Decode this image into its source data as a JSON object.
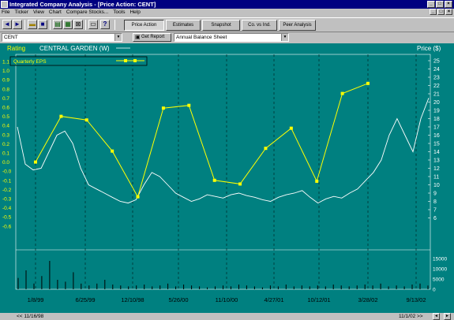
{
  "window": {
    "title": "Integrated Company Analysis - [Price Action:  CENT]"
  },
  "menu": [
    "File",
    "Ticker",
    "View",
    "Chart",
    "Compare Stocks...",
    "Tools",
    "Help"
  ],
  "toolbar": {
    "tabs": [
      {
        "label": "Price Action",
        "active": true
      },
      {
        "label": "Estimates",
        "active": false
      },
      {
        "label": "Snapshot",
        "active": false
      },
      {
        "label": "Co. vs Ind.",
        "active": false
      },
      {
        "label": "Peer Analysis",
        "active": false
      }
    ]
  },
  "ticker_combo": {
    "value": "CENT"
  },
  "get_report_label": "Get Report",
  "report_combo": {
    "value": "Annual Balance Sheet"
  },
  "chart": {
    "rating_label": "Rating",
    "company_name": "CENTRAL GARDEN (W)",
    "price_label": "Price ($)",
    "legend_label": "Quarterly EPS",
    "range_start": "<< 11/16/98",
    "range_end": "11/1/02 >>"
  },
  "chart_data": {
    "type": "line",
    "left_axis": {
      "label": "Rating",
      "ticks": [
        "1.1",
        "1.0",
        "0.9",
        "0.8",
        "0.7",
        "0.6",
        "0.5",
        "0.4",
        "0.3",
        "0.2",
        "0.1",
        "0.0",
        "-0.0",
        "-0.1",
        "-0.2",
        "-0.3",
        "-0.4",
        "-0.5",
        "-0.6"
      ]
    },
    "right_axis": {
      "label": "Price ($)",
      "ylim": [
        6,
        25
      ],
      "ticks": [
        25,
        24,
        23,
        22,
        21,
        20,
        19,
        18,
        17,
        16,
        15,
        14,
        13,
        12,
        11,
        10,
        9,
        8,
        7,
        6
      ]
    },
    "volume_axis": {
      "ticks": [
        "15000",
        "10000",
        "5000",
        "0"
      ]
    },
    "x_ticks": [
      "1/8/99",
      "6/25/99",
      "12/10/98",
      "5/26/00",
      "11/10/00",
      "4/27/01",
      "10/12/01",
      "3/28/02",
      "9/13/02"
    ],
    "series": [
      {
        "name": "Quarterly EPS",
        "color": "#ffff00",
        "values": [
          0.0,
          0.5,
          0.46,
          0.12,
          -0.38,
          0.59,
          0.62,
          -0.2,
          -0.24,
          0.15,
          0.37,
          -0.21,
          0.75,
          0.86
        ]
      }
    ],
    "price_series": {
      "color": "#ffffff",
      "values": [
        17,
        12.5,
        11.8,
        12,
        14,
        16,
        16.5,
        15,
        12,
        10,
        9.5,
        9,
        8.5,
        8,
        7.8,
        8.2,
        10,
        11.5,
        11,
        10,
        9,
        8.5,
        8,
        8.3,
        8.8,
        8.6,
        8.4,
        8.8,
        9,
        8.7,
        8.5,
        8.2,
        8,
        8.5,
        8.8,
        9,
        9.3,
        8.5,
        7.8,
        8.3,
        8.6,
        8.4,
        9,
        9.5,
        10.5,
        11.5,
        13,
        16,
        18,
        16,
        14,
        18,
        20.5
      ]
    },
    "volume_series": {
      "values": [
        12,
        20,
        6,
        14,
        30,
        10,
        8,
        18,
        6,
        4,
        6,
        10,
        5,
        4,
        3,
        4,
        5,
        3,
        4,
        6,
        3,
        5,
        4,
        3,
        2,
        3,
        4,
        3,
        5,
        4,
        3,
        2,
        4,
        3,
        5,
        3,
        4,
        3,
        4,
        3,
        5,
        4,
        3,
        4,
        5,
        4,
        6,
        3,
        4,
        3,
        5,
        6,
        4
      ]
    },
    "grid": true,
    "legend": "top-left"
  }
}
